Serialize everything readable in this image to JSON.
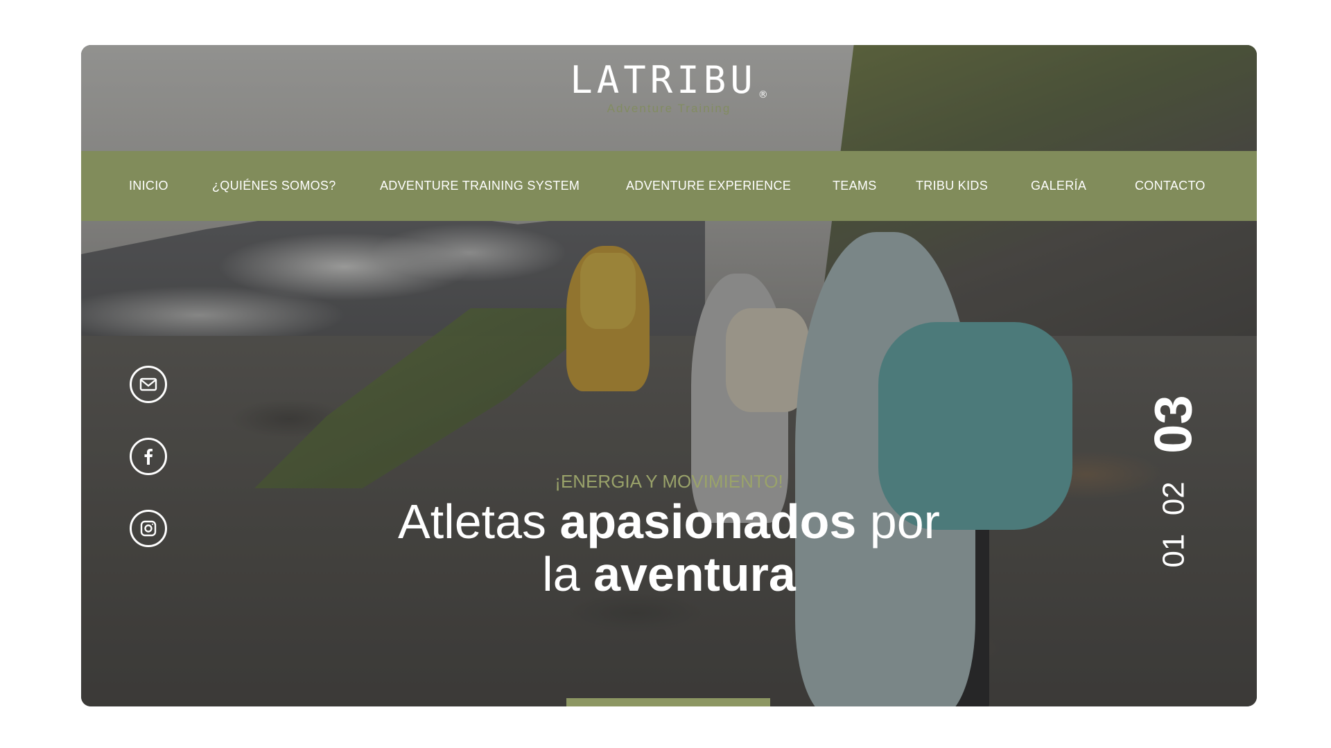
{
  "header": {
    "logo_text": "LATRIBU",
    "logo_mark": "®",
    "logo_tagline": "Adventure Training"
  },
  "nav": {
    "items": [
      {
        "label": "INICIO"
      },
      {
        "label": "¿QUIÉNES SOMOS?"
      },
      {
        "label": "ADVENTURE TRAINING SYSTEM"
      },
      {
        "label": "ADVENTURE EXPERIENCE"
      },
      {
        "label": "TEAMS"
      },
      {
        "label": "TRIBU KIDS"
      },
      {
        "label": "GALERÍA"
      },
      {
        "label": "CONTACTO"
      }
    ],
    "bar_color": "#818c5b"
  },
  "social": [
    {
      "name": "email-icon"
    },
    {
      "name": "facebook-icon"
    },
    {
      "name": "instagram-icon"
    }
  ],
  "hero": {
    "eyebrow": "¡ENERGIA Y MOVIMIENTO!",
    "headline_part1": "Atletas ",
    "headline_bold1": "apasionados",
    "headline_part2": " por",
    "headline_part3": "la ",
    "headline_bold2": "aventura"
  },
  "slider": {
    "pages": [
      "01",
      "02",
      "03"
    ],
    "active": "03",
    "progress_fraction": 0.33
  },
  "colors": {
    "accent": "#818c5b",
    "eyebrow": "#9aa36a"
  }
}
